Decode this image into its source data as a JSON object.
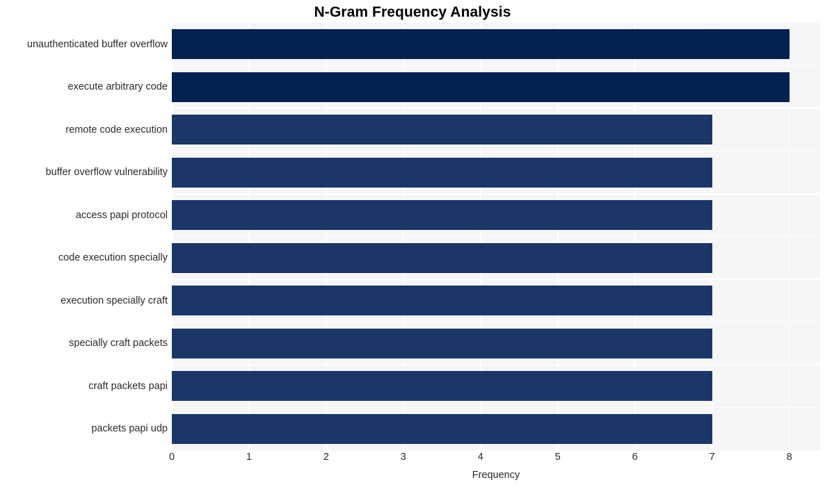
{
  "chart_data": {
    "type": "bar",
    "orientation": "horizontal",
    "title": "N-Gram Frequency Analysis",
    "xlabel": "Frequency",
    "ylabel": "",
    "xlim": [
      0,
      8.4
    ],
    "xticks": [
      0,
      1,
      2,
      3,
      4,
      5,
      6,
      7,
      8
    ],
    "xtick_labels": [
      "0",
      "1",
      "2",
      "3",
      "4",
      "5",
      "6",
      "7",
      "8"
    ],
    "grid": true,
    "legend": "none",
    "categories": [
      "unauthenticated buffer overflow",
      "execute arbitrary code",
      "remote code execution",
      "buffer overflow vulnerability",
      "access papi protocol",
      "code execution specially",
      "execution specially craft",
      "specially craft packets",
      "craft packets papi",
      "packets papi udp"
    ],
    "values": [
      8,
      8,
      7,
      7,
      7,
      7,
      7,
      7,
      7,
      7
    ],
    "bar_colors": [
      "#03224f",
      "#03224f",
      "#1b3768",
      "#1b3768",
      "#1b3768",
      "#1b3768",
      "#1b3768",
      "#1b3768",
      "#1b3768",
      "#1b3768"
    ]
  },
  "style": {
    "plot_background": "#f6f6f7",
    "grid_color": "#ffffff",
    "figure_background": "#ffffff",
    "text_color": "#2b2b2b",
    "title_color": "#000000"
  }
}
